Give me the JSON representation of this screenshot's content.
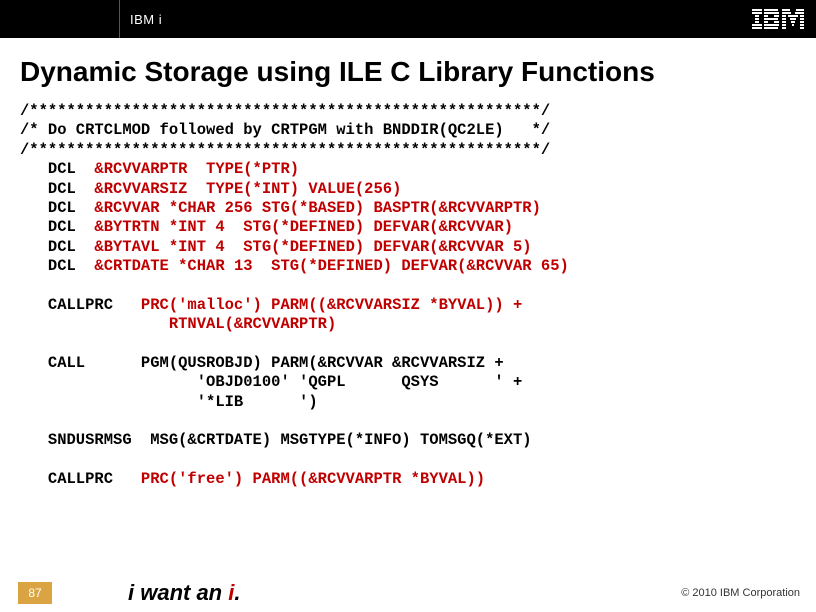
{
  "header": {
    "product": "IBM i",
    "logo_alt": "IBM"
  },
  "title": "Dynamic Storage using ILE C Library Functions",
  "code": {
    "line01": "/*******************************************************/",
    "line02": "/* Do CRTCLMOD followed by CRTPGM with BNDDIR(QC2LE)   */",
    "line03": "/*******************************************************/",
    "line04a": "   DCL  ",
    "line04b": "&RCVVARPTR  TYPE(*PTR)",
    "line05a": "   DCL  ",
    "line05b": "&RCVVARSIZ  TYPE(*INT) VALUE(256)",
    "line06a": "   DCL  ",
    "line06b": "&RCVVAR *CHAR 256 STG(*BASED) BASPTR(&RCVVARPTR)",
    "line07a": "   DCL  ",
    "line07b": "&BYTRTN *INT 4  STG(*DEFINED) DEFVAR(&RCVVAR)",
    "line08a": "   DCL  ",
    "line08b": "&BYTAVL *INT 4  STG(*DEFINED) DEFVAR(&RCVVAR 5)",
    "line09a": "   DCL  ",
    "line09b": "&CRTDATE *CHAR 13  STG(*DEFINED) DEFVAR(&RCVVAR 65)",
    "line10a": "   CALLPRC   ",
    "line10b": "PRC('malloc') PARM((&RCVVARSIZ *BYVAL)) +",
    "line10c": "                RTNVAL(&RCVVARPTR)",
    "line11a": "   CALL      PGM(QUSROBJD) PARM(&RCVVAR &RCVVARSIZ +",
    "line11b": "                   'OBJD0100' 'QGPL      QSYS      ' +",
    "line11c": "                   '*LIB      ')",
    "line12": "   SNDUSRMSG  MSG(&CRTDATE) MSGTYPE(*INFO) TOMSGQ(*EXT)",
    "line13a": "   CALLPRC   ",
    "line13b": "PRC('free') PARM((&RCVVARPTR *BYVAL))"
  },
  "footer": {
    "slide_number": "87",
    "tagline_prefix": "i want an ",
    "tagline_i": "i",
    "tagline_suffix": ".",
    "copyright": "© 2010 IBM Corporation"
  }
}
